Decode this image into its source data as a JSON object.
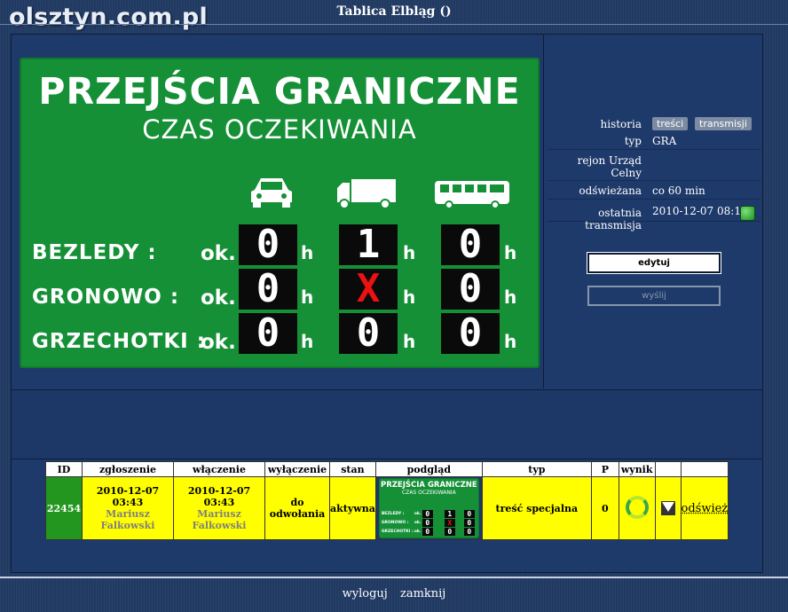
{
  "watermark": "olsztyn.com.pl",
  "page_title": "Tablica Elbląg ()",
  "board": {
    "title": "PRZEJŚCIA GRANICZNE",
    "subtitle": "CZAS OCZEKIWANIA",
    "vehicles": [
      "car-icon",
      "truck-icon",
      "bus-icon"
    ],
    "ok_label": "ok.",
    "unit": "h",
    "rows": [
      {
        "label": "BEZLEDY :",
        "values": [
          "0",
          "1",
          "0"
        ],
        "red": [
          false,
          false,
          false
        ]
      },
      {
        "label": "GRONOWO :",
        "values": [
          "0",
          "X",
          "0"
        ],
        "red": [
          false,
          true,
          false
        ]
      },
      {
        "label": "GRZECHOTKI :",
        "values": [
          "0",
          "0",
          "0"
        ],
        "red": [
          false,
          false,
          false
        ]
      }
    ]
  },
  "info": {
    "historia_label": "historia",
    "tresci_btn": "treści",
    "transmisji_btn": "transmisji",
    "typ_label": "typ",
    "typ_value": "GRA",
    "rejon_label": "rejon Urząd Celny",
    "rejon_value": "",
    "odswiezana_label": "odświeżana",
    "odswiezana_value": "co 60 min",
    "transmisja_label": "ostatnia transmisja",
    "transmisja_value": "2010-12-07 08:12"
  },
  "buttons": {
    "edit": "edytuj",
    "send": "wyślij"
  },
  "table": {
    "headers": [
      "ID",
      "zgłoszenie",
      "włączenie",
      "wyłączenie",
      "stan",
      "podgląd",
      "typ",
      "P",
      "wynik",
      "",
      ""
    ],
    "row": {
      "id": "22454",
      "zgloszenie_date": "2010-12-07 03:43",
      "zgloszenie_user": "Mariusz Falkowski",
      "wlaczenie_date": "2010-12-07 03:43",
      "wlaczenie_user": "Mariusz Falkowski",
      "wylaczenie": "do odwołania",
      "stan": "aktywna",
      "typ": "treść specjalna",
      "p": "0",
      "refresh_link": "odśwież"
    }
  },
  "footer": {
    "logout": "wyloguj",
    "close": "zamknij"
  }
}
